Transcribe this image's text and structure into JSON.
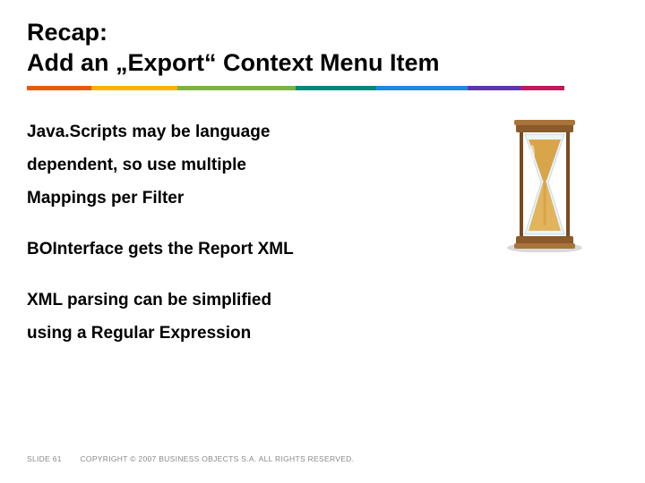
{
  "title": {
    "line1": "Recap:",
    "line2": "Add an „Export“ Context Menu Item"
  },
  "bullets": {
    "group1_line1": "Java.Scripts may be language",
    "group1_line2": "dependent, so use multiple",
    "group1_line3": "Mappings per Filter",
    "group2_line1": "BOInterface gets the Report XML",
    "group3_line1": "XML parsing can be simplified",
    "group3_line2": "using a Regular Expression"
  },
  "footer": {
    "slide": "SLIDE 61",
    "copyright": "COPYRIGHT © 2007 BUSINESS OBJECTS S.A.  ALL RIGHTS RESERVED."
  },
  "icon": {
    "name": "hourglass"
  }
}
